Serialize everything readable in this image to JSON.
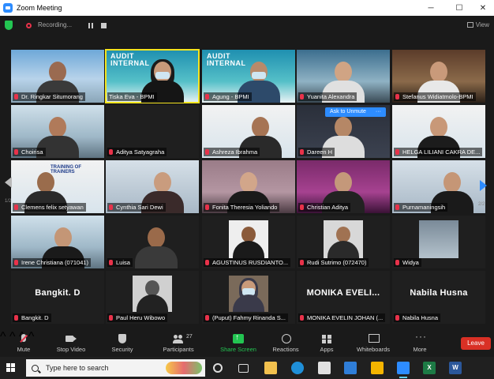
{
  "window": {
    "title": "Zoom Meeting",
    "minimize": "─",
    "maximize": "☐",
    "close": "✕"
  },
  "status": {
    "recording": "Recording...",
    "view": "View"
  },
  "tiles": [
    {
      "name": "Dr. Ringkar Situmorang",
      "muted": true
    },
    {
      "name": "Tiska Eva - BPMI",
      "muted": false,
      "speaking": true,
      "slide": "AUDIT\nINTERNAL"
    },
    {
      "name": "Agung - BPMI",
      "muted": true,
      "slide": "AUDIT\nINTERNAL"
    },
    {
      "name": "Yuanita Alexandra",
      "muted": true
    },
    {
      "name": "Stefanus Widiatmolo-BPMI",
      "muted": true
    },
    {
      "name": "Choirisa",
      "muted": true
    },
    {
      "name": "Aditya Satyagraha",
      "muted": true
    },
    {
      "name": "Ashreza Ibrahma",
      "muted": true
    },
    {
      "name": "Dareen H",
      "muted": true,
      "button": "Ask to Unmute"
    },
    {
      "name": "HELGA LILIANI CAKRA DE...",
      "muted": true
    },
    {
      "name": "Clemens felix setyawan",
      "muted": true,
      "slide": "TRAINING OF\nTRAINERS"
    },
    {
      "name": "Cynthia Sari Dewi",
      "muted": true
    },
    {
      "name": "Fonita Theresia Yoliando",
      "muted": true
    },
    {
      "name": "Christian Aditya",
      "muted": true
    },
    {
      "name": "Purnamaningsih",
      "muted": true
    },
    {
      "name": "Irene Christiana (071041)",
      "muted": true
    },
    {
      "name": "Luisa",
      "muted": true
    },
    {
      "name": "AGUSTINUS RUSDIANTO...",
      "muted": true
    },
    {
      "name": "Rudi Sutrimo (072470)",
      "muted": true
    },
    {
      "name": "Widya",
      "muted": true
    },
    {
      "name": "Bangkit. D",
      "muted": true,
      "big": "Bangkit. D"
    },
    {
      "name": "Paul Heru Wibowo",
      "muted": true
    },
    {
      "name": "(Puput) Fahmy Rinanda S...",
      "muted": true
    },
    {
      "name": "MONIKA EVELIN JOHAN (...",
      "muted": true,
      "big": "MONIKA  EVELI..."
    },
    {
      "name": "Nabila Husna",
      "muted": true,
      "big": "Nabila Husna"
    }
  ],
  "pages": {
    "left": "1/2",
    "right": "2/2"
  },
  "toolbar": {
    "mute": "Mute",
    "stop_video": "Stop Video",
    "security": "Security",
    "participants": "Participants",
    "participants_count": "27",
    "share_screen": "Share Screen",
    "reactions": "Reactions",
    "apps": "Apps",
    "whiteboards": "Whiteboards",
    "more": "More",
    "leave": "Leave"
  },
  "taskbar": {
    "search_placeholder": "Type here to search"
  },
  "colors": {
    "zoom_blue": "#2d8cff",
    "speaker_outline": "#f5e51f",
    "leave_red": "#d93025",
    "share_green": "#23c552",
    "mute_red": "#e8324a"
  }
}
